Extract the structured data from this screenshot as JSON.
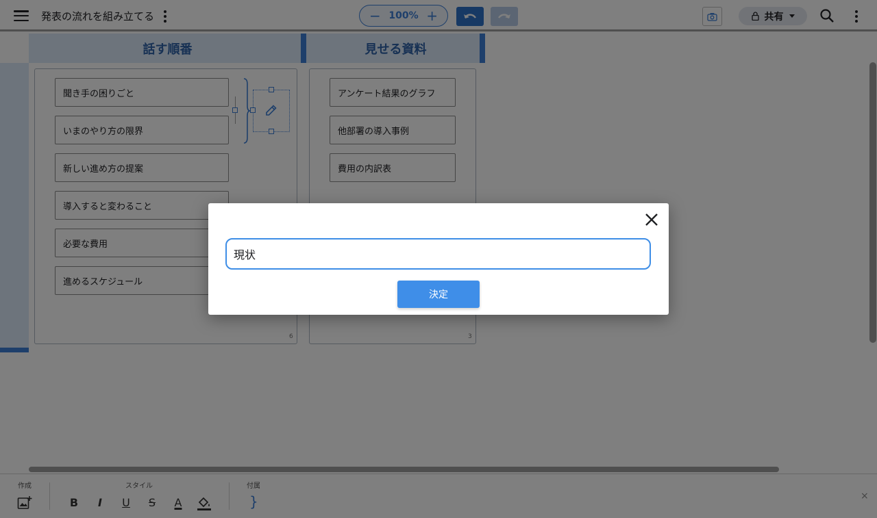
{
  "header": {
    "doc_title": "発表の流れを組み立てる",
    "zoom": {
      "minus": "−",
      "value": "100%",
      "plus": "+"
    },
    "share_label": "共有"
  },
  "columns": [
    {
      "title": "話す順番",
      "items": [
        "聞き手の困りごと",
        "いまのやり方の限界",
        "新しい進め方の提案",
        "導入すると変わること",
        "必要な費用",
        "進めるスケジュール"
      ],
      "count": "6"
    },
    {
      "title": "見せる資料",
      "items": [
        "アンケート結果のグラフ",
        "他部署の導入事例",
        "費用の内訳表"
      ],
      "count": "3"
    }
  ],
  "bottom_toolbar": {
    "create_label": "作成",
    "style_label": "スタイル",
    "attach_label": "付属",
    "format_buttons": {
      "bold": "B",
      "italic": "I",
      "underline": "U",
      "strike": "S",
      "font_color": "A"
    },
    "brace": "}",
    "close": "×"
  },
  "dialog": {
    "input_value": "現状",
    "ok_label": "決定"
  },
  "colors": {
    "accent": "#3d7fd6",
    "header_bg": "#dbe9f9",
    "button_blue": "#3f8ee8"
  }
}
